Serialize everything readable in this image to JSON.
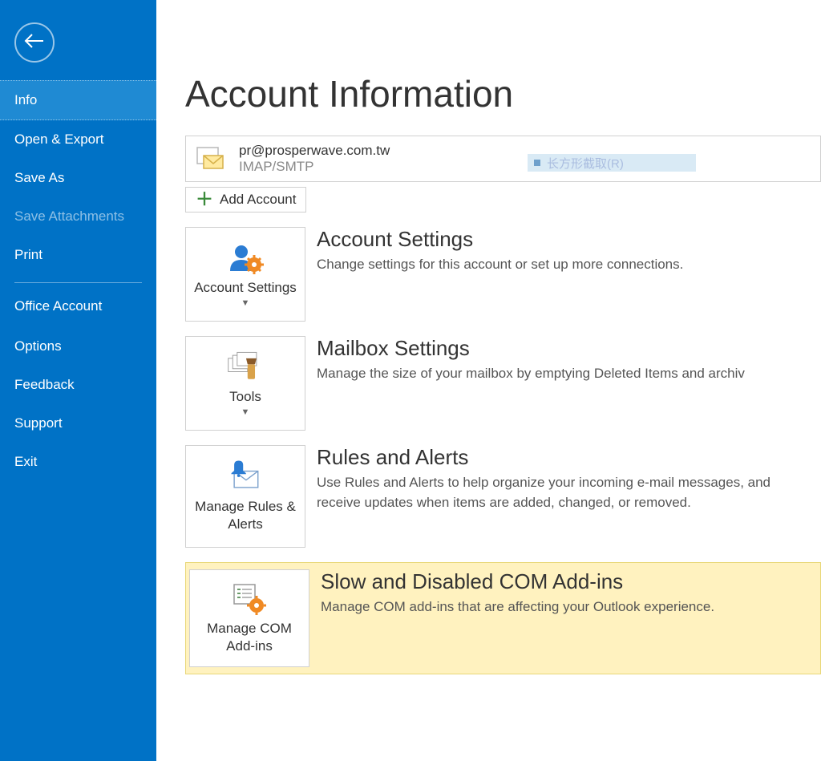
{
  "sidebar": {
    "items": [
      {
        "label": "Info",
        "state": "selected"
      },
      {
        "label": "Open & Export",
        "state": "normal"
      },
      {
        "label": "Save As",
        "state": "normal"
      },
      {
        "label": "Save Attachments",
        "state": "disabled"
      },
      {
        "label": "Print",
        "state": "normal"
      }
    ],
    "bottom_items": [
      {
        "label": "Office Account"
      },
      {
        "label": "Options"
      },
      {
        "label": "Feedback"
      },
      {
        "label": "Support"
      },
      {
        "label": "Exit"
      }
    ]
  },
  "main": {
    "title": "Account Information",
    "account": {
      "email": "pr@prosperwave.com.tw",
      "protocol": "IMAP/SMTP",
      "obscured_hint": "长方形截取(R)"
    },
    "add_account_label": "Add Account",
    "sections": [
      {
        "button_label": "Account Settings",
        "has_dropdown": true,
        "title": "Account Settings",
        "desc": "Change settings for this account or set up more connections."
      },
      {
        "button_label": "Tools",
        "has_dropdown": true,
        "title": "Mailbox Settings",
        "desc": "Manage the size of your mailbox by emptying Deleted Items and archiv"
      },
      {
        "button_label": "Manage Rules & Alerts",
        "has_dropdown": false,
        "title": "Rules and Alerts",
        "desc": "Use Rules and Alerts to help organize your incoming e-mail messages, and receive updates when items are added, changed, or removed."
      },
      {
        "button_label": "Manage COM Add-ins",
        "has_dropdown": false,
        "title": "Slow and Disabled COM Add-ins",
        "desc": "Manage COM add-ins that are affecting your Outlook experience.",
        "highlight": true
      }
    ]
  }
}
